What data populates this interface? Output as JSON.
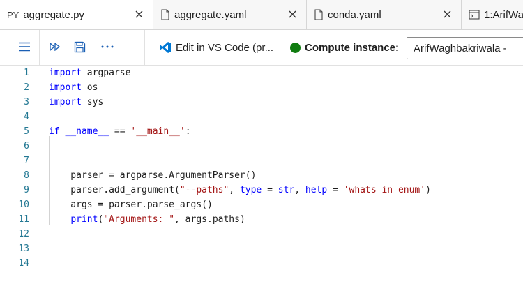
{
  "tabs": [
    {
      "icon": "PY",
      "label": "aggregate.py",
      "active": true
    },
    {
      "icon": "file-icon",
      "label": "aggregate.yaml"
    },
    {
      "icon": "file-icon",
      "label": "conda.yaml"
    },
    {
      "icon": "terminal-icon",
      "label": "1:ArifWa"
    }
  ],
  "toolbar": {
    "vscode_label": "Edit in VS Code (pr...",
    "compute_label": "Compute instance:",
    "compute_value": "ArifWaghbakriwala   -",
    "status_color": "#107c10"
  },
  "editor": {
    "lines": [
      {
        "n": "1",
        "tokens": [
          {
            "t": "import",
            "c": "kw"
          },
          {
            "t": " argparse",
            "c": ""
          }
        ]
      },
      {
        "n": "2",
        "tokens": [
          {
            "t": "import",
            "c": "kw"
          },
          {
            "t": " os",
            "c": ""
          }
        ]
      },
      {
        "n": "3",
        "tokens": [
          {
            "t": "import",
            "c": "kw"
          },
          {
            "t": " sys",
            "c": ""
          }
        ]
      },
      {
        "n": "4",
        "tokens": []
      },
      {
        "n": "5",
        "tokens": [
          {
            "t": "if",
            "c": "kw"
          },
          {
            "t": " ",
            "c": ""
          },
          {
            "t": "__name__",
            "c": "kw"
          },
          {
            "t": " == ",
            "c": ""
          },
          {
            "t": "'__main__'",
            "c": "str"
          },
          {
            "t": ":",
            "c": ""
          }
        ]
      },
      {
        "n": "6",
        "tokens": []
      },
      {
        "n": "7",
        "tokens": []
      },
      {
        "n": "8",
        "tokens": [
          {
            "t": "    parser = argparse.ArgumentParser()",
            "c": ""
          }
        ]
      },
      {
        "n": "9",
        "tokens": [
          {
            "t": "    parser.add_argument(",
            "c": ""
          },
          {
            "t": "\"--paths\"",
            "c": "str"
          },
          {
            "t": ", ",
            "c": ""
          },
          {
            "t": "type",
            "c": "kw"
          },
          {
            "t": " = ",
            "c": ""
          },
          {
            "t": "str",
            "c": "kw"
          },
          {
            "t": ", ",
            "c": ""
          },
          {
            "t": "help",
            "c": "kw"
          },
          {
            "t": " = ",
            "c": ""
          },
          {
            "t": "'whats in enum'",
            "c": "str"
          },
          {
            "t": ")",
            "c": ""
          }
        ]
      },
      {
        "n": "10",
        "tokens": [
          {
            "t": "    args = parser.parse_args()",
            "c": ""
          }
        ]
      },
      {
        "n": "11",
        "tokens": [
          {
            "t": "    ",
            "c": ""
          },
          {
            "t": "print",
            "c": "kw"
          },
          {
            "t": "(",
            "c": ""
          },
          {
            "t": "\"Arguments: \"",
            "c": "str"
          },
          {
            "t": ", args.paths)",
            "c": ""
          }
        ]
      },
      {
        "n": "12",
        "tokens": []
      },
      {
        "n": "13",
        "tokens": []
      },
      {
        "n": "14",
        "tokens": []
      }
    ]
  }
}
